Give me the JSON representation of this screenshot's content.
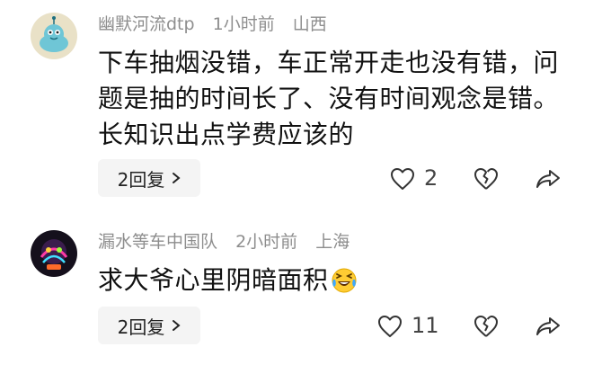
{
  "comments": [
    {
      "username": "幽默河流dtp",
      "time": "1小时前",
      "location": "山西",
      "text": "下车抽烟没错，车正常开走也没有错，问题是抽的时间长了、没有时间观念是错。长知识出点学费应该的",
      "reply_label": "2回复",
      "like_count": "2",
      "avatar_icon": "cartoon-blob-avatar"
    },
    {
      "username": "漏水等车中国队",
      "time": "2小时前",
      "location": "上海",
      "text": "求大爷心里阴暗面积",
      "emoji": "laughing-crying-emoji",
      "reply_label": "2回复",
      "like_count": "11",
      "avatar_icon": "neon-photo-avatar"
    }
  ],
  "colors": {
    "meta_text": "#8e8e8e",
    "body_text": "#111111",
    "reply_bg": "#f4f4f4",
    "icon_stroke": "#333333"
  }
}
